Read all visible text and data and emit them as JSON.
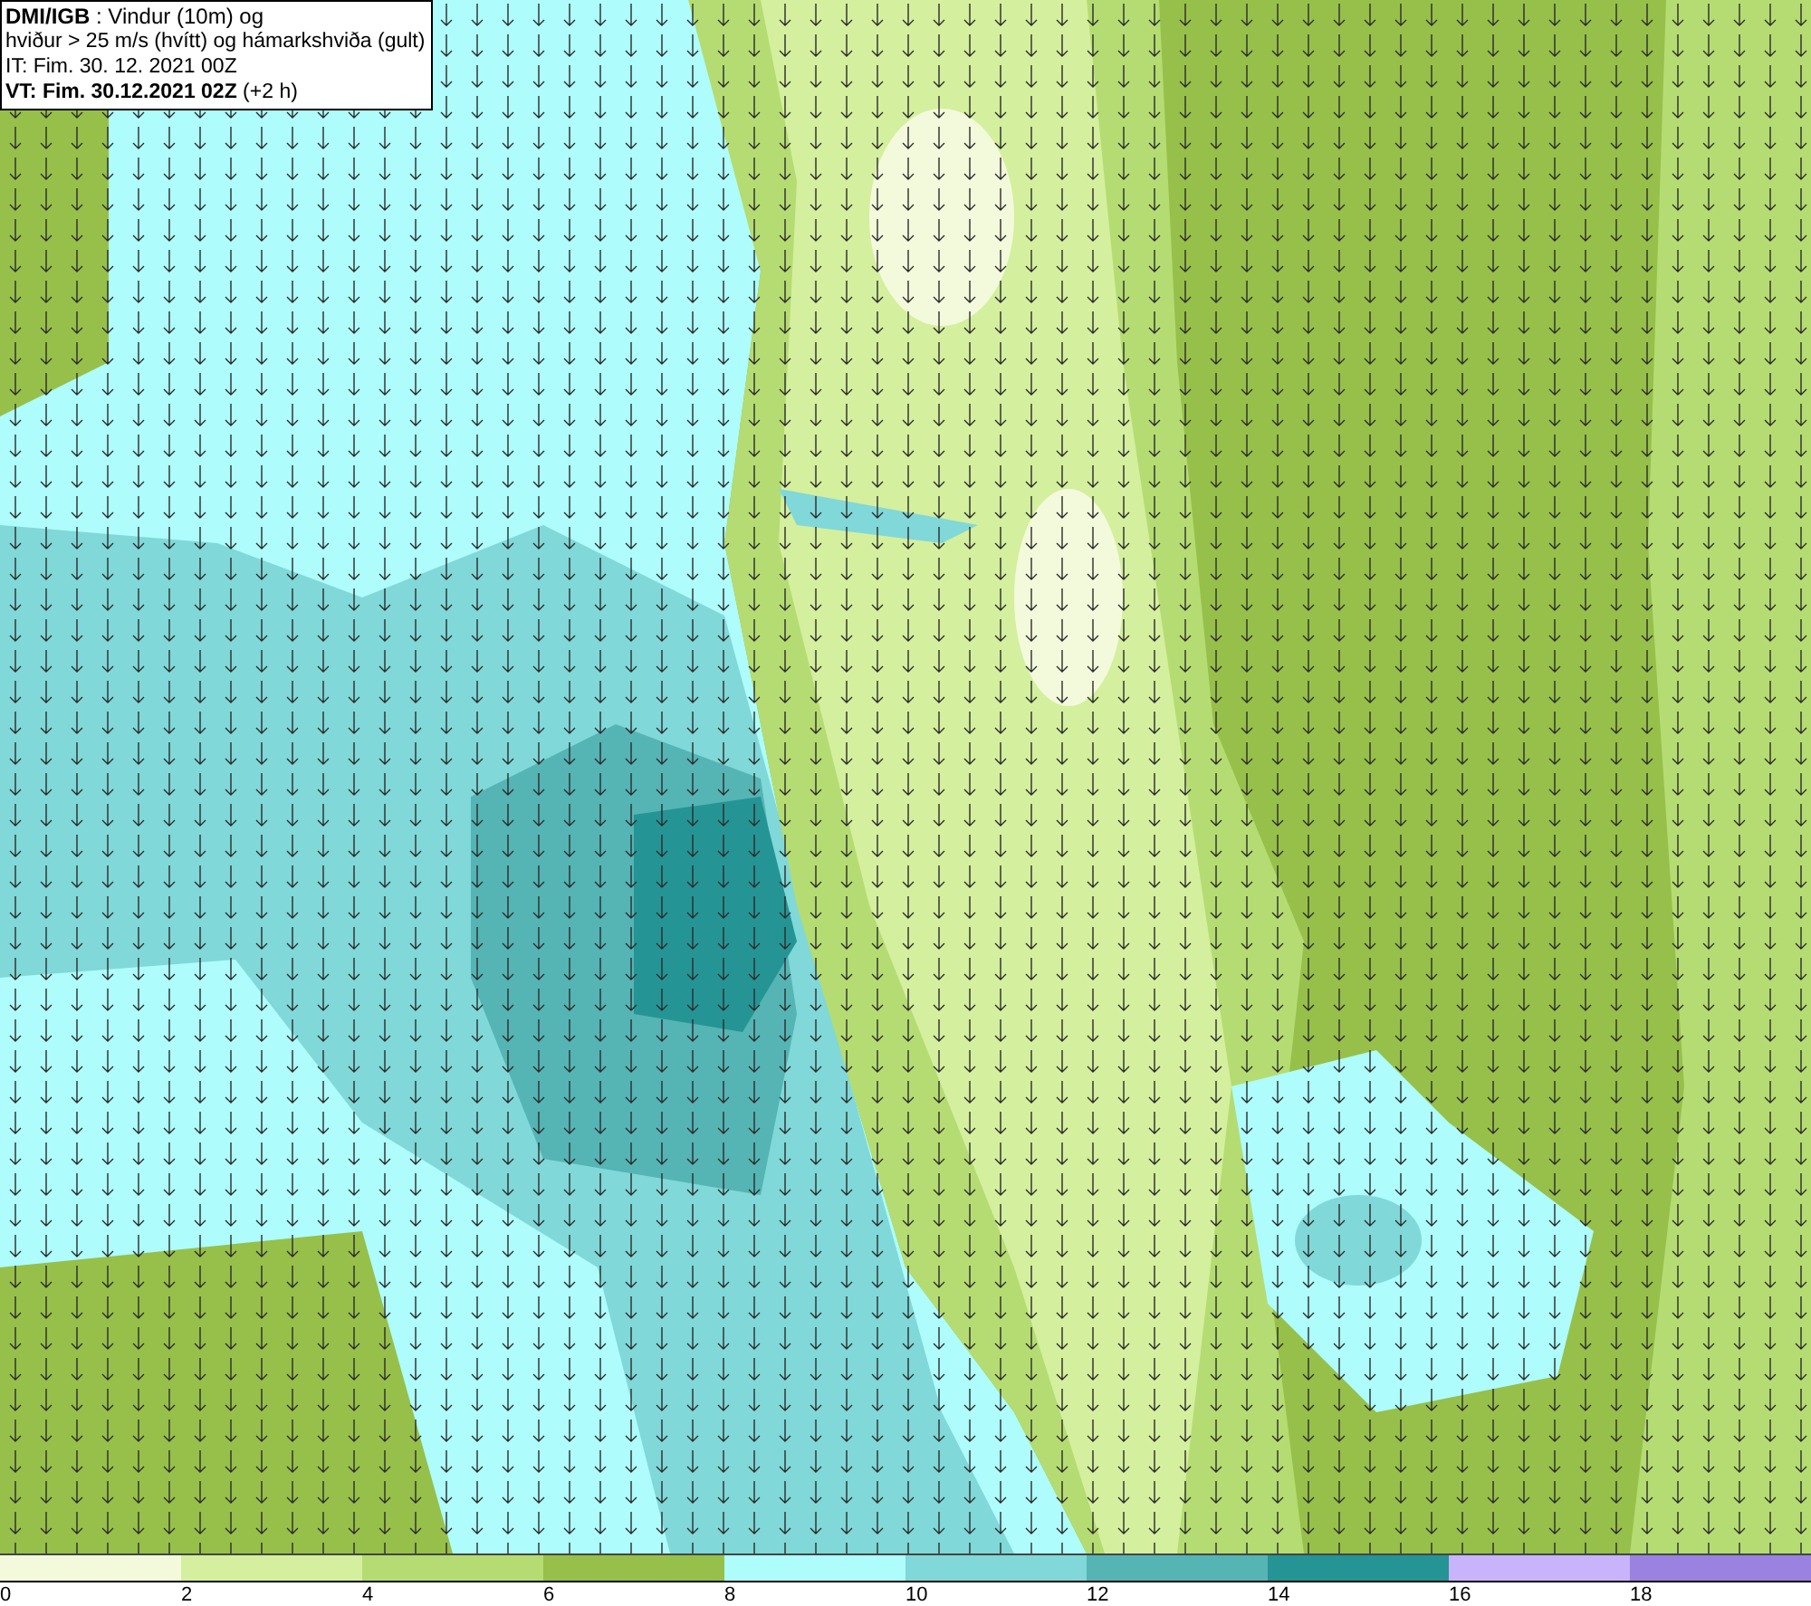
{
  "info_box": {
    "lines": [
      "**DMI/IGB** : Vindur (10m) og",
      "hviður > 25 m/s (hvítt) og hámarkshviða (gult)",
      "IT: Fim. 30. 12. 2021 00Z",
      "**VT: Fim. 30.12.2021 02Z** (+2 h)"
    ]
  },
  "legend": {
    "bins": [
      {
        "color": "#f3fadb"
      },
      {
        "color": "#d4ef9e"
      },
      {
        "color": "#b5dc72"
      },
      {
        "color": "#96c04a"
      },
      {
        "color": "#aefcfc"
      },
      {
        "color": "#80d8d8"
      },
      {
        "color": "#55b4b4"
      },
      {
        "color": "#259494"
      },
      {
        "color": "#c8b4fa"
      },
      {
        "color": "#9a82e0"
      }
    ],
    "labels": [
      "0",
      "2",
      "4",
      "6",
      "8",
      "10",
      "12",
      "14",
      "16",
      "18"
    ]
  }
}
